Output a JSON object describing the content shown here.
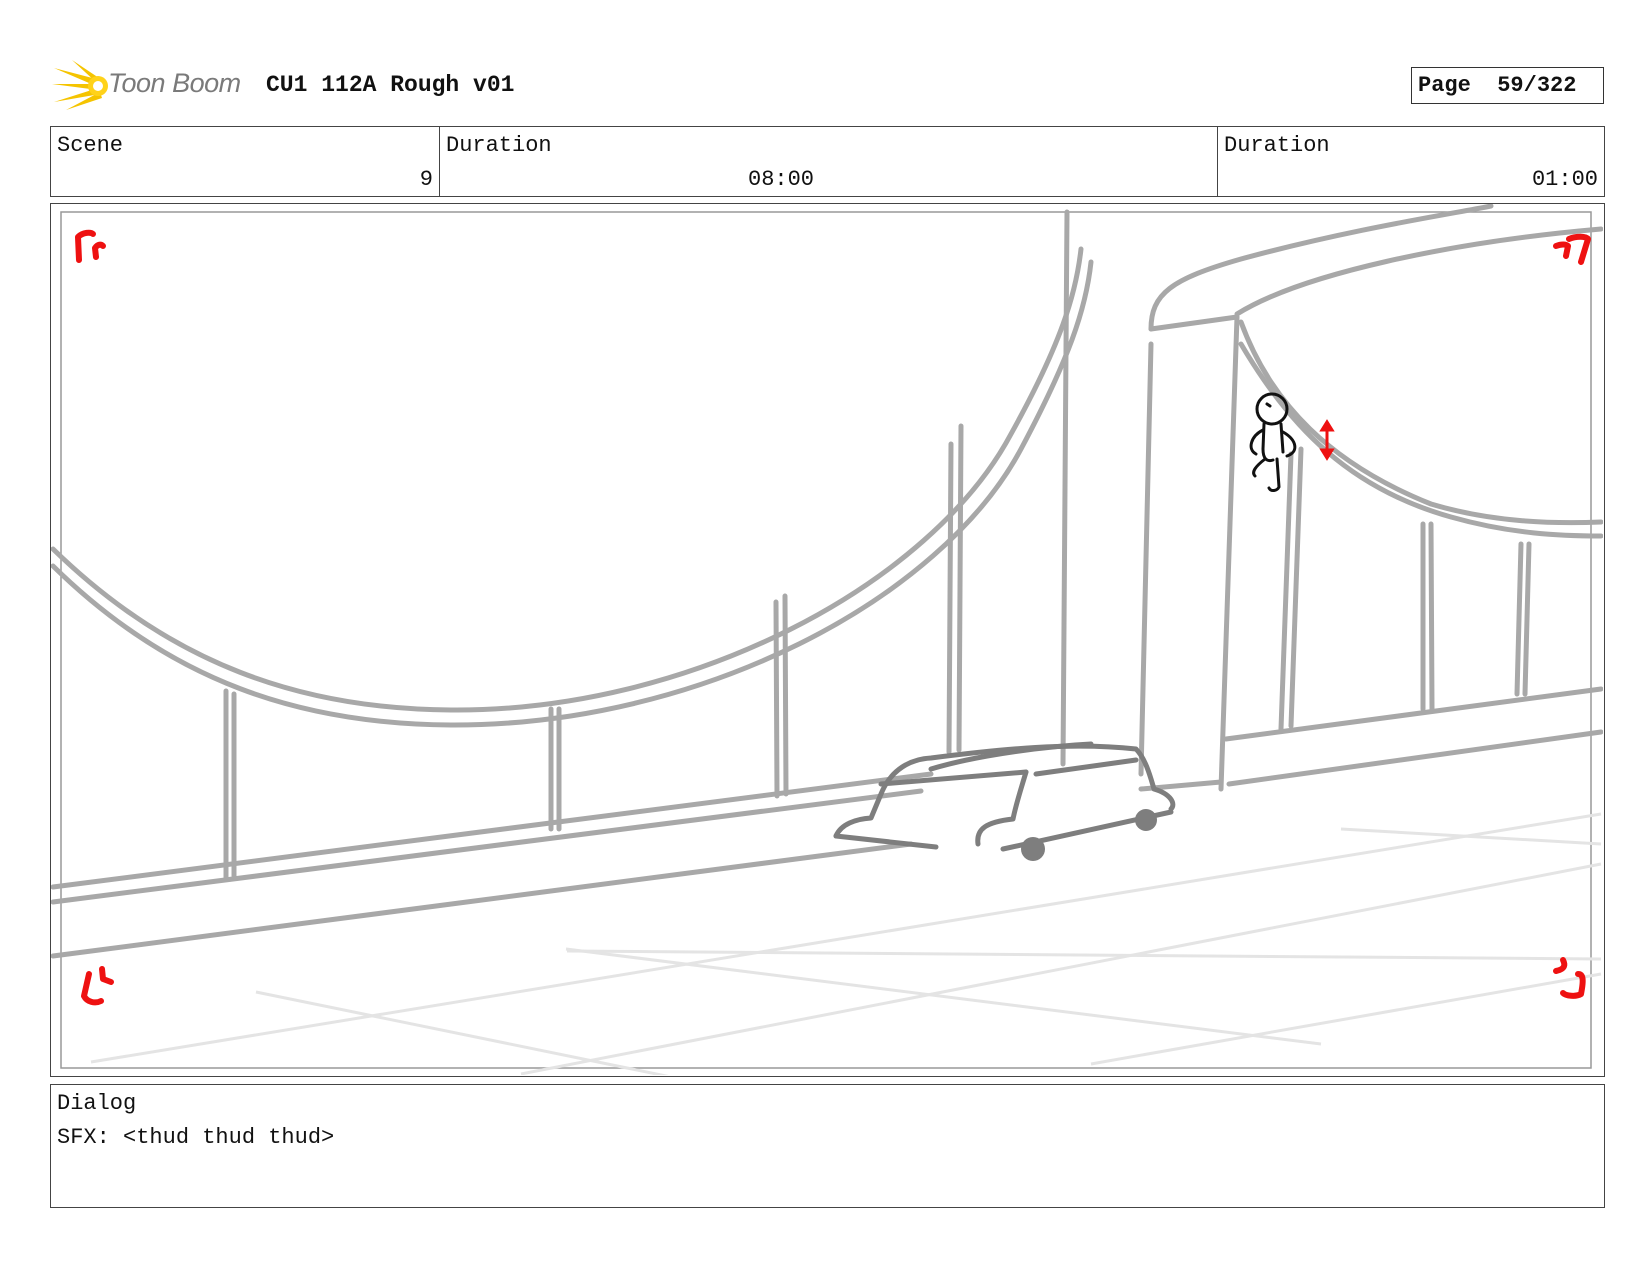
{
  "header": {
    "logo_text": "Toon Boom",
    "title": "CU1 112A Rough v01",
    "page_label": "Page",
    "page_value": "59/322"
  },
  "info": {
    "scene_label": "Scene",
    "scene_value": "9",
    "duration1_label": "Duration",
    "duration1_value": "08:00",
    "duration2_label": "Duration",
    "duration2_value": "01:00"
  },
  "dialog": {
    "label": "Dialog",
    "text": "SFX: <thud thud thud>"
  },
  "colors": {
    "sketch": "#a8a8a8",
    "sketch_dark": "#808080",
    "guide_marks": "#ee1111",
    "logo_accent": "#f5c400"
  }
}
